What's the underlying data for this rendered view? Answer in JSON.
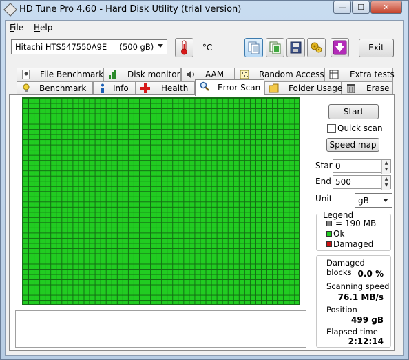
{
  "window": {
    "title": "HD Tune Pro 4.60 - Hard Disk Utility (trial version)"
  },
  "caption_buttons": {
    "minimize": "—",
    "maximize": "☐",
    "close": "✕"
  },
  "menu": [
    {
      "label": "File",
      "accel": "F",
      "rest": "ile"
    },
    {
      "label": "Help",
      "accel": "H",
      "rest": "elp"
    }
  ],
  "toolbar": {
    "drive": "Hitachi HTS547550A9E     (500 gB)",
    "temperature": "– °C",
    "exit_label": "Exit",
    "icons": [
      "thermometer-icon",
      "copy-text-icon",
      "copy-screenshot-icon",
      "save-icon",
      "options-icon",
      "download-icon"
    ]
  },
  "tabs_row1": [
    "File Benchmark",
    "Disk monitor",
    "AAM",
    "Random Access",
    "Extra tests"
  ],
  "tabs_row2": [
    "Benchmark",
    "Info",
    "Health",
    "Error Scan",
    "Folder Usage",
    "Erase"
  ],
  "active_tab": "Error Scan",
  "error_scan": {
    "start_button": "Start",
    "quick_scan_label": "Quick scan",
    "quick_scan_checked": false,
    "speed_map_button": "Speed map",
    "start_label": "Start",
    "start_value": "0",
    "end_label": "End",
    "end_value": "500",
    "unit_label": "Unit",
    "unit_value": "gB",
    "legend": {
      "title": "Legend",
      "block_size": "= 190 MB",
      "ok": "Ok",
      "damaged": "Damaged"
    },
    "stats": {
      "damaged_blocks_label": "Damaged blocks",
      "damaged_blocks_value": "0.0 %",
      "scanning_speed_label": "Scanning speed",
      "scanning_speed_value": "76.1 MB/s",
      "position_label": "Position",
      "position_value": "499 gB",
      "elapsed_label": "Elapsed time",
      "elapsed_value": "2:12:14"
    },
    "block_status": "all ok",
    "colors": {
      "ok": "#21cc21",
      "damaged": "#cc1111",
      "block": "#808080"
    }
  }
}
